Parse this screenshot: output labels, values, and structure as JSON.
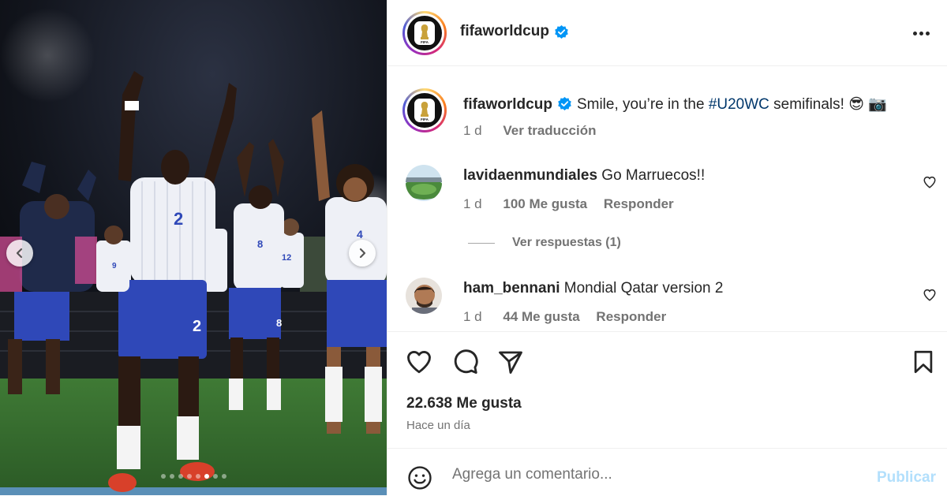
{
  "post": {
    "author": "fifaworldcup",
    "avatar_badge_text": "FIFA",
    "caption_pre": "Smile, you’re in the ",
    "caption_hashtag": "#U20WC",
    "caption_post": " semifinals! 😎 📷",
    "caption_age": "1 d",
    "translate_label": "Ver traducción",
    "likes": "22.638 Me gusta",
    "time_ago": "Hace un día"
  },
  "media": {
    "slide_count": 8,
    "active_slide": 5,
    "jersey_numbers": [
      "2",
      "8",
      "4",
      "12",
      "9",
      "2",
      "8"
    ],
    "prev_icon": "chevron-left-icon",
    "next_icon": "chevron-right-icon"
  },
  "comments": [
    {
      "username": "lavidaenmundiales",
      "text": "Go Marruecos!!",
      "age": "1 d",
      "likes": "100 Me gusta",
      "reply_label": "Responder",
      "view_replies": "Ver respuestas (1)"
    },
    {
      "username": "ham_bennani",
      "text": "Mondial Qatar version 2",
      "age": "1 d",
      "likes": "44 Me gusta",
      "reply_label": "Responder"
    }
  ],
  "comment_box": {
    "placeholder": "Agrega un comentario...",
    "publish_label": "Publicar"
  },
  "icons": {
    "like": "heart-icon",
    "comment": "comment-bubble-icon",
    "share": "paper-plane-icon",
    "save": "bookmark-icon",
    "emoji": "emoji-smile-icon",
    "more": "more-options-icon",
    "verified": "verified-badge-icon"
  },
  "colors": {
    "hashtag": "#00376b",
    "verified": "#0095f6",
    "publish_disabled": "#b2dffc",
    "muted": "#737373"
  }
}
